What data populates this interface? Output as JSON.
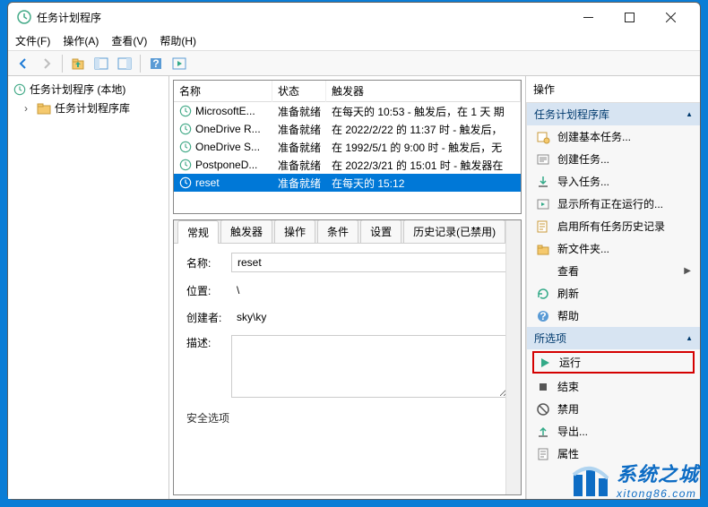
{
  "window": {
    "title": "任务计划程序"
  },
  "menu": {
    "file": "文件(F)",
    "action": "操作(A)",
    "view": "查看(V)",
    "help": "帮助(H)"
  },
  "tree": {
    "root": "任务计划程序 (本地)",
    "library": "任务计划程序库"
  },
  "list": {
    "headers": {
      "name": "名称",
      "status": "状态",
      "trigger": "触发器"
    },
    "rows": [
      {
        "name": "MicrosoftE...",
        "status": "准备就绪",
        "trigger": "在每天的 10:53 - 触发后，在 1 天 期"
      },
      {
        "name": "OneDrive R...",
        "status": "准备就绪",
        "trigger": "在 2022/2/22 的 11:37 时 - 触发后，"
      },
      {
        "name": "OneDrive S...",
        "status": "准备就绪",
        "trigger": "在 1992/5/1 的 9:00 时 - 触发后，无"
      },
      {
        "name": "PostponeD...",
        "status": "准备就绪",
        "trigger": "在 2022/3/21 的 15:01 时 - 触发器在"
      },
      {
        "name": "reset",
        "status": "准备就绪",
        "trigger": "在每天的 15:12"
      }
    ],
    "selected_index": 4
  },
  "tabs": {
    "items": [
      "常规",
      "触发器",
      "操作",
      "条件",
      "设置",
      "历史记录(已禁用)"
    ],
    "active_index": 0
  },
  "detail": {
    "name_label": "名称:",
    "name_value": "reset",
    "location_label": "位置:",
    "location_value": "\\",
    "author_label": "创建者:",
    "author_value": "sky\\ky",
    "desc_label": "描述:",
    "desc_value": "",
    "security_title": "安全选项"
  },
  "actions": {
    "title": "操作",
    "section1": "任务计划程序库",
    "section1_items": [
      {
        "icon": "create-basic",
        "label": "创建基本任务..."
      },
      {
        "icon": "create",
        "label": "创建任务..."
      },
      {
        "icon": "import",
        "label": "导入任务..."
      },
      {
        "icon": "show-running",
        "label": "显示所有正在运行的..."
      },
      {
        "icon": "enable-history",
        "label": "启用所有任务历史记录"
      },
      {
        "icon": "new-folder",
        "label": "新文件夹..."
      },
      {
        "icon": "view",
        "label": "查看"
      },
      {
        "icon": "refresh",
        "label": "刷新"
      },
      {
        "icon": "help",
        "label": "帮助"
      }
    ],
    "section2": "所选项",
    "section2_items": [
      {
        "icon": "run",
        "label": "运行",
        "highlight": true
      },
      {
        "icon": "end",
        "label": "结束"
      },
      {
        "icon": "disable",
        "label": "禁用"
      },
      {
        "icon": "export",
        "label": "导出..."
      },
      {
        "icon": "properties",
        "label": "属性"
      }
    ]
  },
  "watermark": {
    "big": "系统之城",
    "small": "xitong86.com"
  }
}
